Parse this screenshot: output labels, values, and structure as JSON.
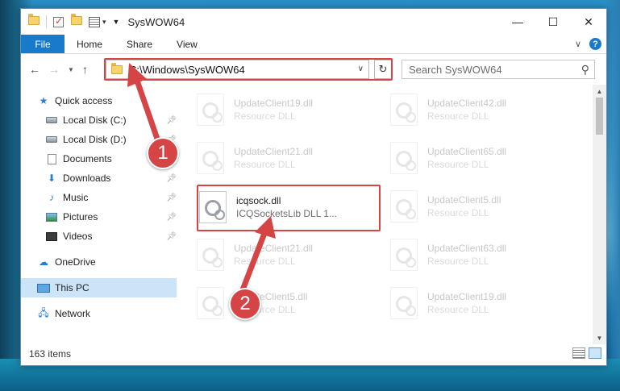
{
  "window": {
    "title": "SysWOW64",
    "controls": {
      "minimize": "—",
      "maximize": "☐",
      "close": "✕"
    }
  },
  "ribbon": {
    "file_tab": "File",
    "tabs": [
      "Home",
      "Share",
      "View"
    ],
    "help": "?"
  },
  "address": {
    "path": "C:\\Windows\\SysWOW64",
    "refresh_icon": "↻"
  },
  "search": {
    "placeholder": "Search SysWOW64"
  },
  "navigation": {
    "quick_access": "Quick access",
    "items": [
      {
        "label": "Local Disk (C:)",
        "icon": "drive-icon",
        "pinned": true
      },
      {
        "label": "Local Disk (D:)",
        "icon": "drive-icon",
        "pinned": true
      },
      {
        "label": "Documents",
        "icon": "documents-icon",
        "pinned": true
      },
      {
        "label": "Downloads",
        "icon": "download-icon",
        "pinned": true
      },
      {
        "label": "Music",
        "icon": "music-icon",
        "pinned": true
      },
      {
        "label": "Pictures",
        "icon": "pictures-icon",
        "pinned": true
      },
      {
        "label": "Videos",
        "icon": "videos-icon",
        "pinned": true
      }
    ],
    "onedrive": "OneDrive",
    "this_pc": "This PC",
    "network": "Network"
  },
  "files": [
    {
      "name": "UpdateClient19.dll",
      "desc": "Resource DLL",
      "faded": true
    },
    {
      "name": "UpdateClient42.dll",
      "desc": "Resource DLL",
      "faded": true
    },
    {
      "name": "UpdateClient21.dll",
      "desc": "Resource DLL",
      "faded": true
    },
    {
      "name": "UpdateClient65.dll",
      "desc": "Resource DLL",
      "faded": true
    },
    {
      "name": "icqsock.dll",
      "desc": "ICQSocketsLib DLL 1...",
      "faded": false
    },
    {
      "name": "UpdateClient5.dll",
      "desc": "Resource DLL",
      "faded": true
    },
    {
      "name": "UpdateClient21.dll",
      "desc": "Resource DLL",
      "faded": true
    },
    {
      "name": "UpdateClient63.dll",
      "desc": "Resource DLL",
      "faded": true
    },
    {
      "name": "UpdateClient5.dll",
      "desc": "Resource DLL",
      "faded": true
    },
    {
      "name": "UpdateClient19.dll",
      "desc": "Resource DLL",
      "faded": true
    }
  ],
  "status": {
    "item_count": "163 items"
  },
  "annotations": {
    "marker_1": "1",
    "marker_2": "2",
    "color": "#d64545"
  }
}
